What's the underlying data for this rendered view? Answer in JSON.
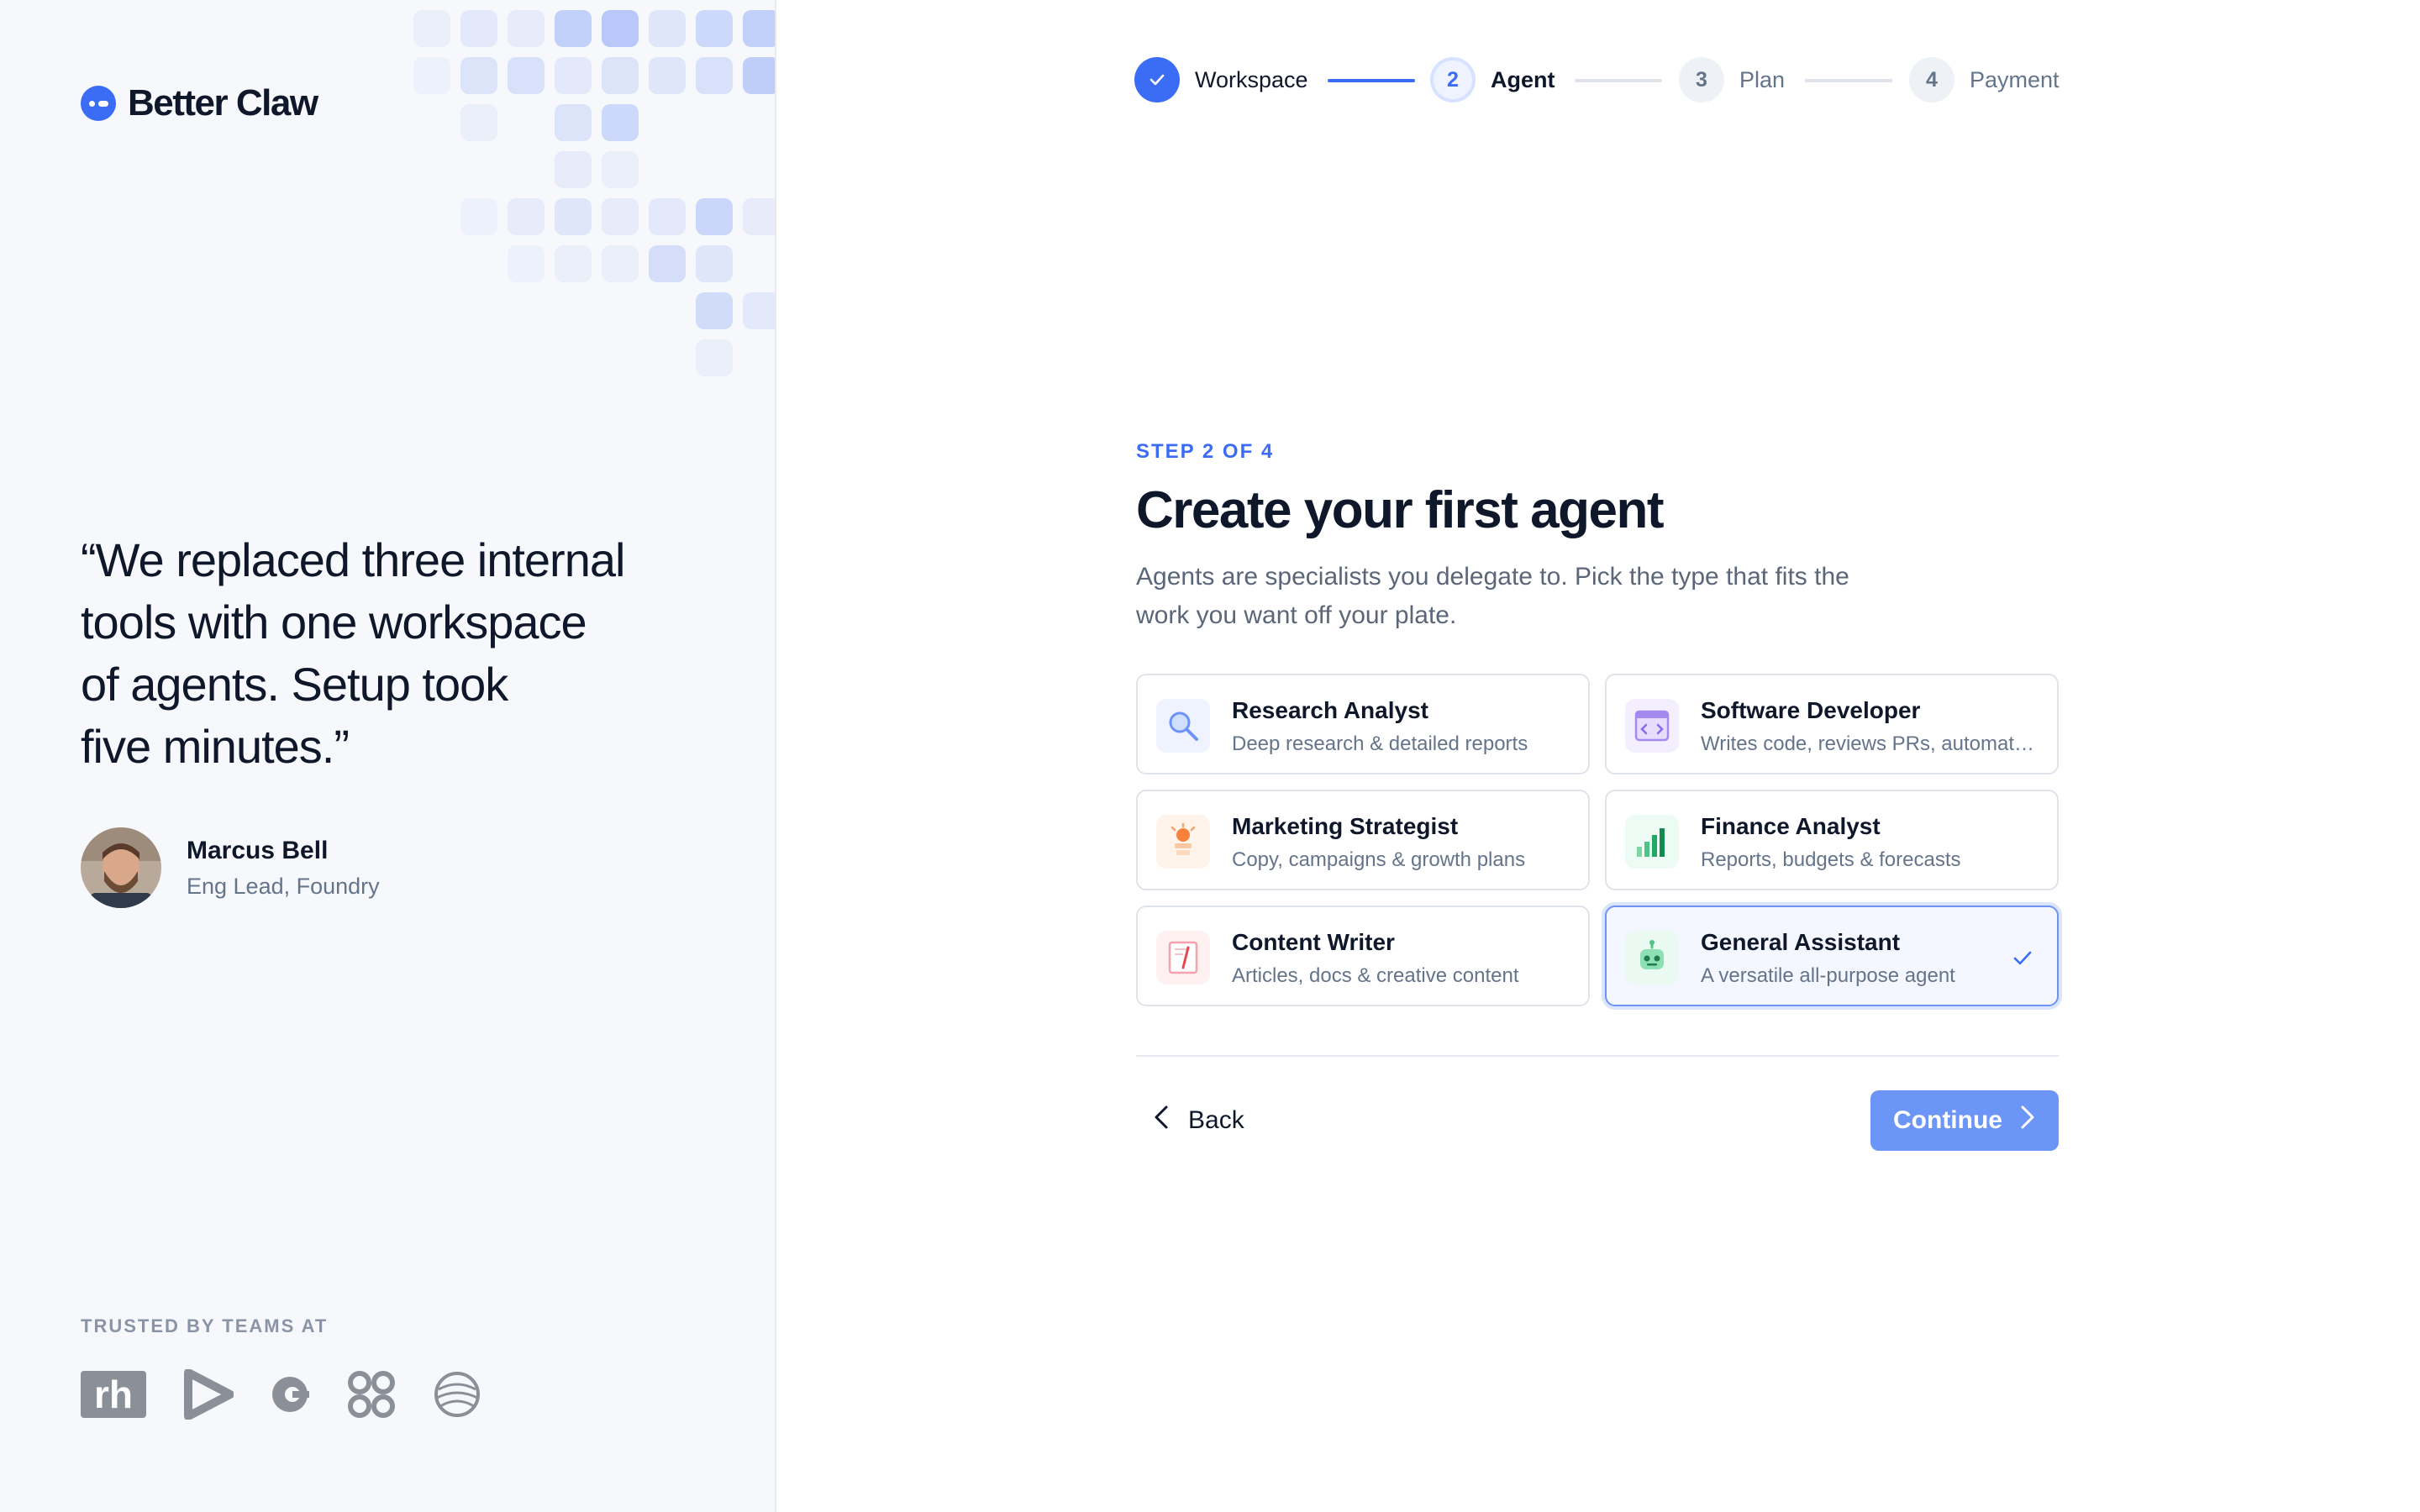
{
  "brand": {
    "name": "Better Claw",
    "accent": "#3b6cf6"
  },
  "testimonial": {
    "quote_lines": [
      "“We replaced three internal",
      "tools with one workspace",
      "of agents. Setup took",
      "five minutes.”"
    ],
    "author_name": "Marcus Bell",
    "author_role": "Eng Lead, Foundry"
  },
  "trusted": {
    "label": "TRUSTED BY TEAMS AT",
    "logos": [
      "rh-logo",
      "play-logo",
      "c-logo",
      "knot-logo",
      "globe-logo"
    ]
  },
  "stepper": {
    "steps": [
      {
        "number": "",
        "label": "Workspace",
        "state": "done"
      },
      {
        "number": "2",
        "label": "Agent",
        "state": "current"
      },
      {
        "number": "3",
        "label": "Plan",
        "state": "todo"
      },
      {
        "number": "4",
        "label": "Payment",
        "state": "todo"
      }
    ]
  },
  "header": {
    "eyebrow": "STEP 2 OF 4",
    "title": "Create your first agent",
    "subtitle": "Agents are specialists you delegate to. Pick the type that fits the work you want off your plate."
  },
  "agents": [
    {
      "title": "Research Analyst",
      "desc": "Deep research & detailed reports",
      "icon": "magnifier-icon",
      "selected": false
    },
    {
      "title": "Software Developer",
      "desc": "Writes code, reviews PRs, automates tasks",
      "icon": "code-window-icon",
      "selected": false
    },
    {
      "title": "Marketing Strategist",
      "desc": "Copy, campaigns & growth plans",
      "icon": "megaphone-icon",
      "selected": false
    },
    {
      "title": "Finance Analyst",
      "desc": "Reports, budgets & forecasts",
      "icon": "bar-chart-icon",
      "selected": false
    },
    {
      "title": "Content Writer",
      "desc": "Articles, docs & creative content",
      "icon": "notepad-icon",
      "selected": false
    },
    {
      "title": "General Assistant",
      "desc": "A versatile all-purpose agent",
      "icon": "robot-icon",
      "selected": true
    }
  ],
  "footer": {
    "back_label": "Back",
    "continue_label": "Continue"
  },
  "colors": {
    "primary": "#3b6cf6",
    "continue_bg": "#6b96f7",
    "selected_border": "#6d93f7"
  }
}
